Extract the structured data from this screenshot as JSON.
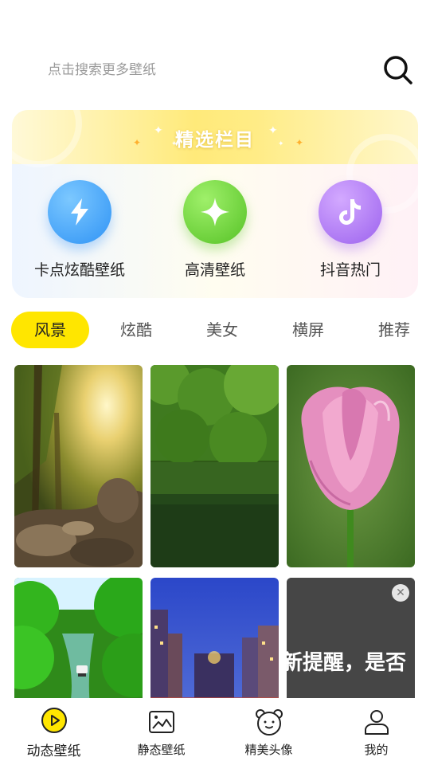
{
  "search": {
    "placeholder": "点击搜索更多壁纸",
    "icon": "search-icon"
  },
  "featured": {
    "title": "精选栏目",
    "items": [
      {
        "label": "卡点炫酷壁纸",
        "icon": "lightning-icon",
        "color": "#3fa4ff"
      },
      {
        "label": "高清壁纸",
        "icon": "sparkle-star-icon",
        "color": "#6fd43a"
      },
      {
        "label": "抖音热门",
        "icon": "tiktok-note-icon",
        "color": "#b27df5"
      }
    ]
  },
  "tabs": [
    {
      "label": "风景",
      "active": true
    },
    {
      "label": "炫酷",
      "active": false
    },
    {
      "label": "美女",
      "active": false
    },
    {
      "label": "横屏",
      "active": false
    },
    {
      "label": "推荐",
      "active": false
    }
  ],
  "wallpapers": [
    {
      "subject": "forest-sunlight-rocks"
    },
    {
      "subject": "green-lake-forest"
    },
    {
      "subject": "pink-tulip"
    },
    {
      "subject": "green-river-boat"
    },
    {
      "subject": "city-street-night"
    },
    {
      "subject": "ad-placeholder"
    }
  ],
  "ad_overlay": {
    "text": "新提醒，是否"
  },
  "bottom_nav": [
    {
      "label": "动态壁纸",
      "icon": "play-circle-icon",
      "active": true
    },
    {
      "label": "静态壁纸",
      "icon": "image-icon",
      "active": false
    },
    {
      "label": "精美头像",
      "icon": "bear-face-icon",
      "active": false
    },
    {
      "label": "我的",
      "icon": "user-icon",
      "active": false
    }
  ],
  "colors": {
    "accent_yellow": "#ffe600",
    "blue": "#3fa4ff",
    "green": "#6fd43a",
    "purple": "#b27df5"
  }
}
